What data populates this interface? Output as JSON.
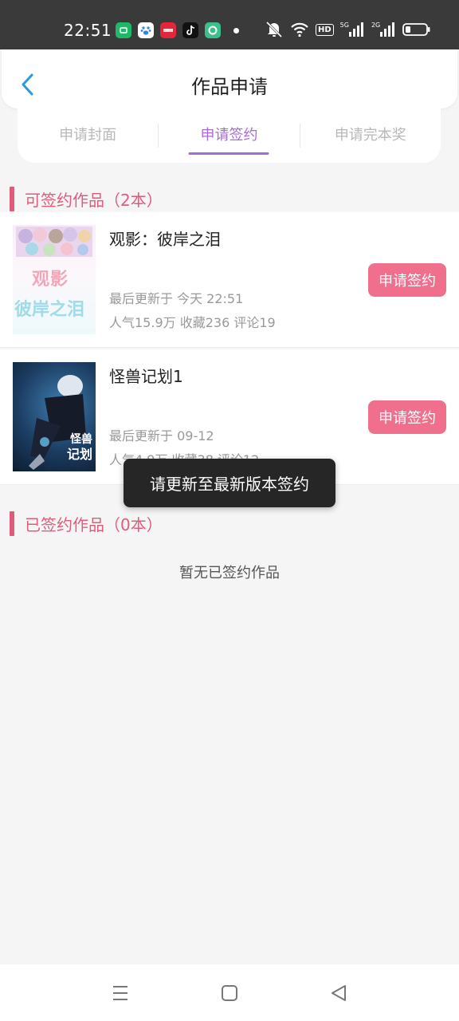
{
  "status_bar": {
    "time": "22:51",
    "apps": [
      {
        "icon": "green-app-icon",
        "color": "#1fb86a"
      },
      {
        "icon": "baidu-paw-icon",
        "color": "#2f7fe8"
      },
      {
        "icon": "red-app-icon",
        "color": "#e3263a"
      },
      {
        "icon": "tiktok-icon",
        "color": "#111111"
      },
      {
        "icon": "green-circle-app-icon",
        "color": "#3cbf8a"
      }
    ],
    "hd_label": "HD",
    "net1_label": "5G",
    "net2_label": "2G",
    "battery_level": 0.2
  },
  "header": {
    "title": "作品申请",
    "back_icon": "chevron-left-icon",
    "accent": "#2a9ad8"
  },
  "tabs": [
    {
      "label": "申请封面",
      "active": false
    },
    {
      "label": "申请签约",
      "active": true
    },
    {
      "label": "申请完本奖",
      "active": false
    }
  ],
  "signable": {
    "heading": "可签约作品（2本）",
    "works": [
      {
        "title": "观影：彼岸之泪",
        "updated": "最后更新于 今天 22:51",
        "stats": "人气15.9万 收藏236 评论19",
        "button": "申请签约",
        "cover_text_1": "观影",
        "cover_text_2": "彼岸之泪"
      },
      {
        "title": "怪兽记划1",
        "updated": "最后更新于 09-12",
        "stats": "人气4.9万 收藏38 评论12",
        "button": "申请签约",
        "cover_text_1": "怪兽",
        "cover_text_2": "记划"
      }
    ]
  },
  "signed": {
    "heading": "已签约作品（0本）",
    "empty_text": "暂无已签约作品"
  },
  "toast": "请更新至最新版本签约",
  "colors": {
    "primary_pink": "#e05c7d",
    "button_pink": "#ef6f8c",
    "tab_active": "#a86bd6"
  },
  "nav_bar": {
    "menu_icon": "menu-icon",
    "home_icon": "square-home-icon",
    "back_icon": "triangle-back-icon"
  }
}
